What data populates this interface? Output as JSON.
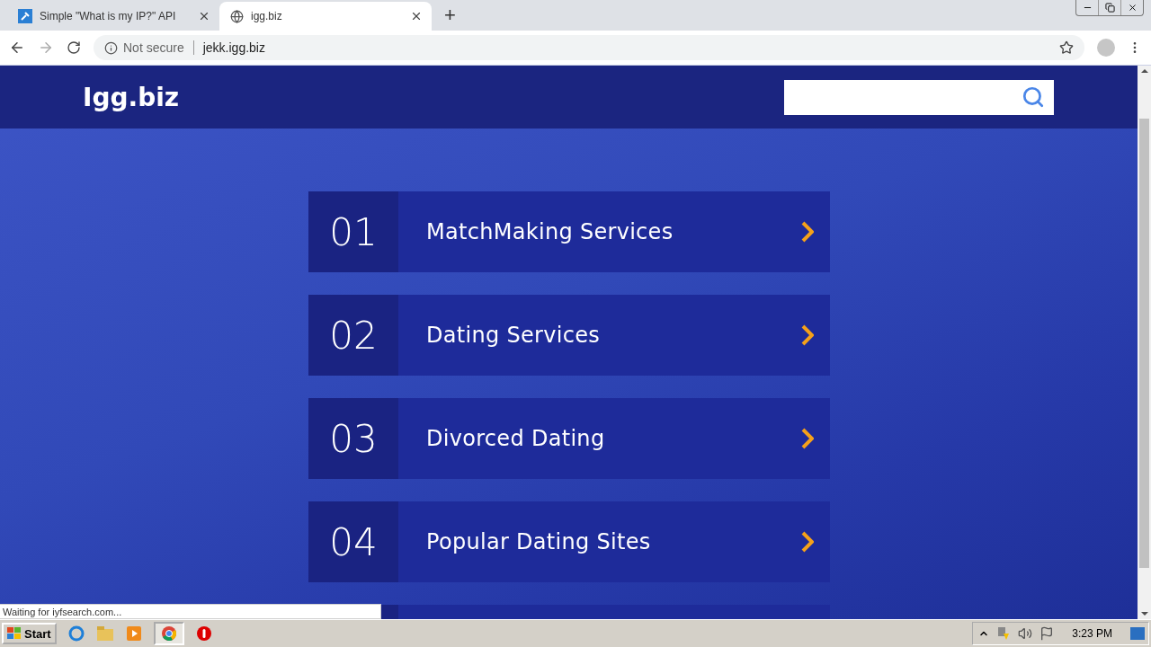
{
  "browser": {
    "tabs": [
      {
        "title": "Simple \"What is my IP?\" API",
        "selected": false,
        "kind": "api"
      },
      {
        "title": "igg.biz",
        "selected": true,
        "kind": "globe"
      }
    ],
    "new_tab": "+",
    "security": "Not secure",
    "url": "jekk.igg.biz",
    "status": "Waiting for iyfsearch.com..."
  },
  "site": {
    "logo": "Igg.biz",
    "items": [
      {
        "number": "01",
        "label": "MatchMaking Services"
      },
      {
        "number": "02",
        "label": "Dating Services"
      },
      {
        "number": "03",
        "label": "Divorced Dating"
      },
      {
        "number": "04",
        "label": "Popular Dating Sites"
      }
    ]
  },
  "taskbar": {
    "start": "Start",
    "clock": "3:23 PM"
  }
}
